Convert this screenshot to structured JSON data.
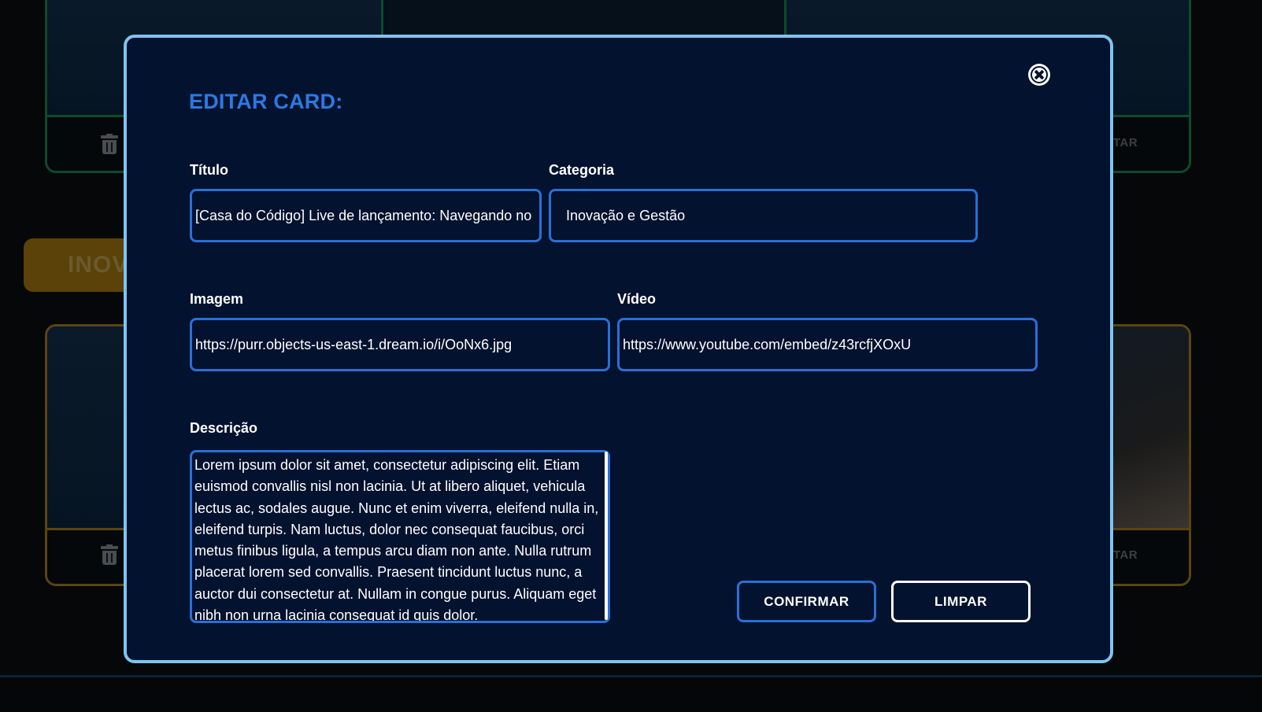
{
  "background": {
    "category_label": "INOV",
    "edit_label": "TAR"
  },
  "modal": {
    "title": "EDITAR CARD:",
    "fields": {
      "titulo": {
        "label": "Título",
        "value": "[Casa do Código] Live de lançamento: Navegando no U"
      },
      "categoria": {
        "label": "Categoria",
        "value": "Inovação e Gestão"
      },
      "imagem": {
        "label": "Imagem",
        "value": "https://purr.objects-us-east-1.dream.io/i/OoNx6.jpg"
      },
      "video": {
        "label": "Vídeo",
        "value": "https://www.youtube.com/embed/z43rcfjXOxU"
      },
      "descricao": {
        "label": "Descrição",
        "value": "Lorem ipsum dolor sit amet, consectetur adipiscing elit. Etiam euismod convallis nisl non lacinia. Ut at libero aliquet, vehicula lectus ac, sodales augue. Nunc et enim viverra, eleifend nulla in, eleifend turpis. Nam luctus, dolor nec consequat faucibus, orci metus finibus ligula, a tempus arcu diam non ante. Nulla rutrum placerat lorem sed convallis. Praesent tincidunt luctus nunc, a auctor dui consectetur at. Nullam in congue purus. Aliquam eget nibh non urna lacinia consequat id quis dolor."
      }
    },
    "buttons": {
      "confirm": "CONFIRMAR",
      "clear": "LIMPAR"
    }
  },
  "icons": {
    "close": "close-circle-icon",
    "delete": "trash-icon"
  },
  "colors": {
    "modal_background": "#03122e",
    "modal_border": "#7ec4f0",
    "accent_blue": "#2a7ae2",
    "input_border": "#2a6fd6",
    "card_border_green": "#0e4a2c",
    "card_border_yellow": "#5c4410",
    "category_yellow": "#5a4208"
  }
}
